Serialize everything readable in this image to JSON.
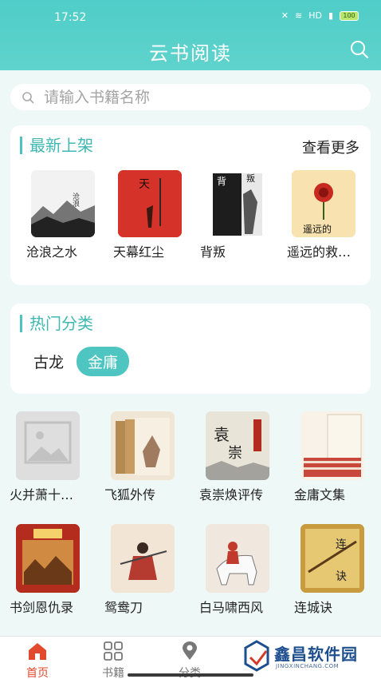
{
  "status": {
    "time": "17:52",
    "battery": "100",
    "net": "HD"
  },
  "app": {
    "title": "云书阅读"
  },
  "search": {
    "placeholder": "请输入书籍名称"
  },
  "new_shelf": {
    "title": "最新上架",
    "more": "查看更多",
    "books": [
      {
        "name": "沧浪之水",
        "cover": "ink-landscape"
      },
      {
        "name": "天幕红尘",
        "cover": "red-cover"
      },
      {
        "name": "背叛",
        "cover": "bw-cover"
      },
      {
        "name": "遥远的救…",
        "cover": "flower-cover"
      }
    ]
  },
  "hot": {
    "title": "热门分类",
    "categories": [
      {
        "label": "古龙",
        "active": false
      },
      {
        "label": "金庸",
        "active": true
      }
    ]
  },
  "grid": [
    {
      "name": "火并萧十…",
      "cover": "placeholder-image"
    },
    {
      "name": "飞狐外传",
      "cover": "boxset"
    },
    {
      "name": "袁崇焕评传",
      "cover": "calligraphy"
    },
    {
      "name": "金庸文集",
      "cover": "boxset-red"
    },
    {
      "name": "书剑恩仇录",
      "cover": "painting-red"
    },
    {
      "name": "鸳鸯刀",
      "cover": "warriors"
    },
    {
      "name": "白马啸西风",
      "cover": "horse"
    },
    {
      "name": "连城诀",
      "cover": "sword"
    }
  ],
  "nav": {
    "items": [
      {
        "label": "首页",
        "icon": "home-icon",
        "active": true
      },
      {
        "label": "书籍",
        "icon": "grid-icon",
        "active": false
      },
      {
        "label": "分类",
        "icon": "location-pin-icon",
        "active": false
      }
    ]
  },
  "watermark": {
    "text": "鑫昌软件园",
    "sub": "JINGXINCHANG.COM"
  },
  "colors": {
    "accent": "#4fcdc8",
    "nav_active": "#e24a2f"
  }
}
